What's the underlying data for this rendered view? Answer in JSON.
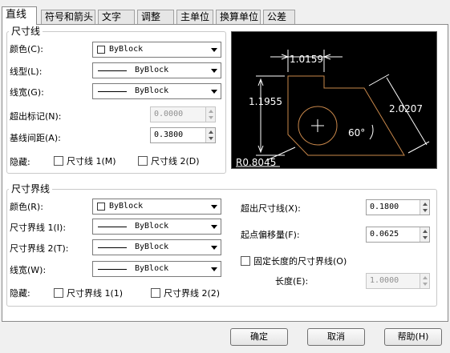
{
  "tabs": [
    "直线",
    "符号和箭头",
    "文字",
    "调整",
    "主单位",
    "换算单位",
    "公差"
  ],
  "dim_lines": {
    "title": "尺寸线",
    "color_label": "颜色(C):",
    "color_value": "ByBlock",
    "linetype_label": "线型(L):",
    "linetype_value": "ByBlock",
    "lineweight_label": "线宽(G):",
    "lineweight_value": "ByBlock",
    "extend_ticks_label": "超出标记(N):",
    "extend_ticks_value": "0.0000",
    "baseline_spacing_label": "基线间距(A):",
    "baseline_spacing_value": "0.3800",
    "suppress_label": "隐藏:",
    "suppress_1": "尺寸线 1(M)",
    "suppress_2": "尺寸线 2(D)"
  },
  "preview": {
    "dim_top": "1.0159",
    "dim_left": "1.1955",
    "dim_right": "2.0207",
    "angle": "60°",
    "radius": "R0.8045"
  },
  "ext_lines": {
    "title": "尺寸界线",
    "color_label": "颜色(R):",
    "color_value": "ByBlock",
    "linetype1_label": "尺寸界线 1(I):",
    "linetype1_value": "ByBlock",
    "linetype2_label": "尺寸界线 2(T):",
    "linetype2_value": "ByBlock",
    "lineweight_label": "线宽(W):",
    "lineweight_value": "ByBlock",
    "suppress_label": "隐藏:",
    "suppress_1": "尺寸界线 1(1)",
    "suppress_2": "尺寸界线 2(2)",
    "extend_label": "超出尺寸线(X):",
    "extend_value": "0.1800",
    "offset_label": "起点偏移量(F):",
    "offset_value": "0.0625",
    "fixed_length_label": "固定长度的尺寸界线(O)",
    "length_label": "长度(E):",
    "length_value": "1.0000"
  },
  "buttons": {
    "ok": "确定",
    "cancel": "取消",
    "help": "帮助(H)"
  },
  "colors": {
    "preview_bg": "#000000",
    "preview_geometry": "#c8874a",
    "preview_text": "#ffffff"
  }
}
